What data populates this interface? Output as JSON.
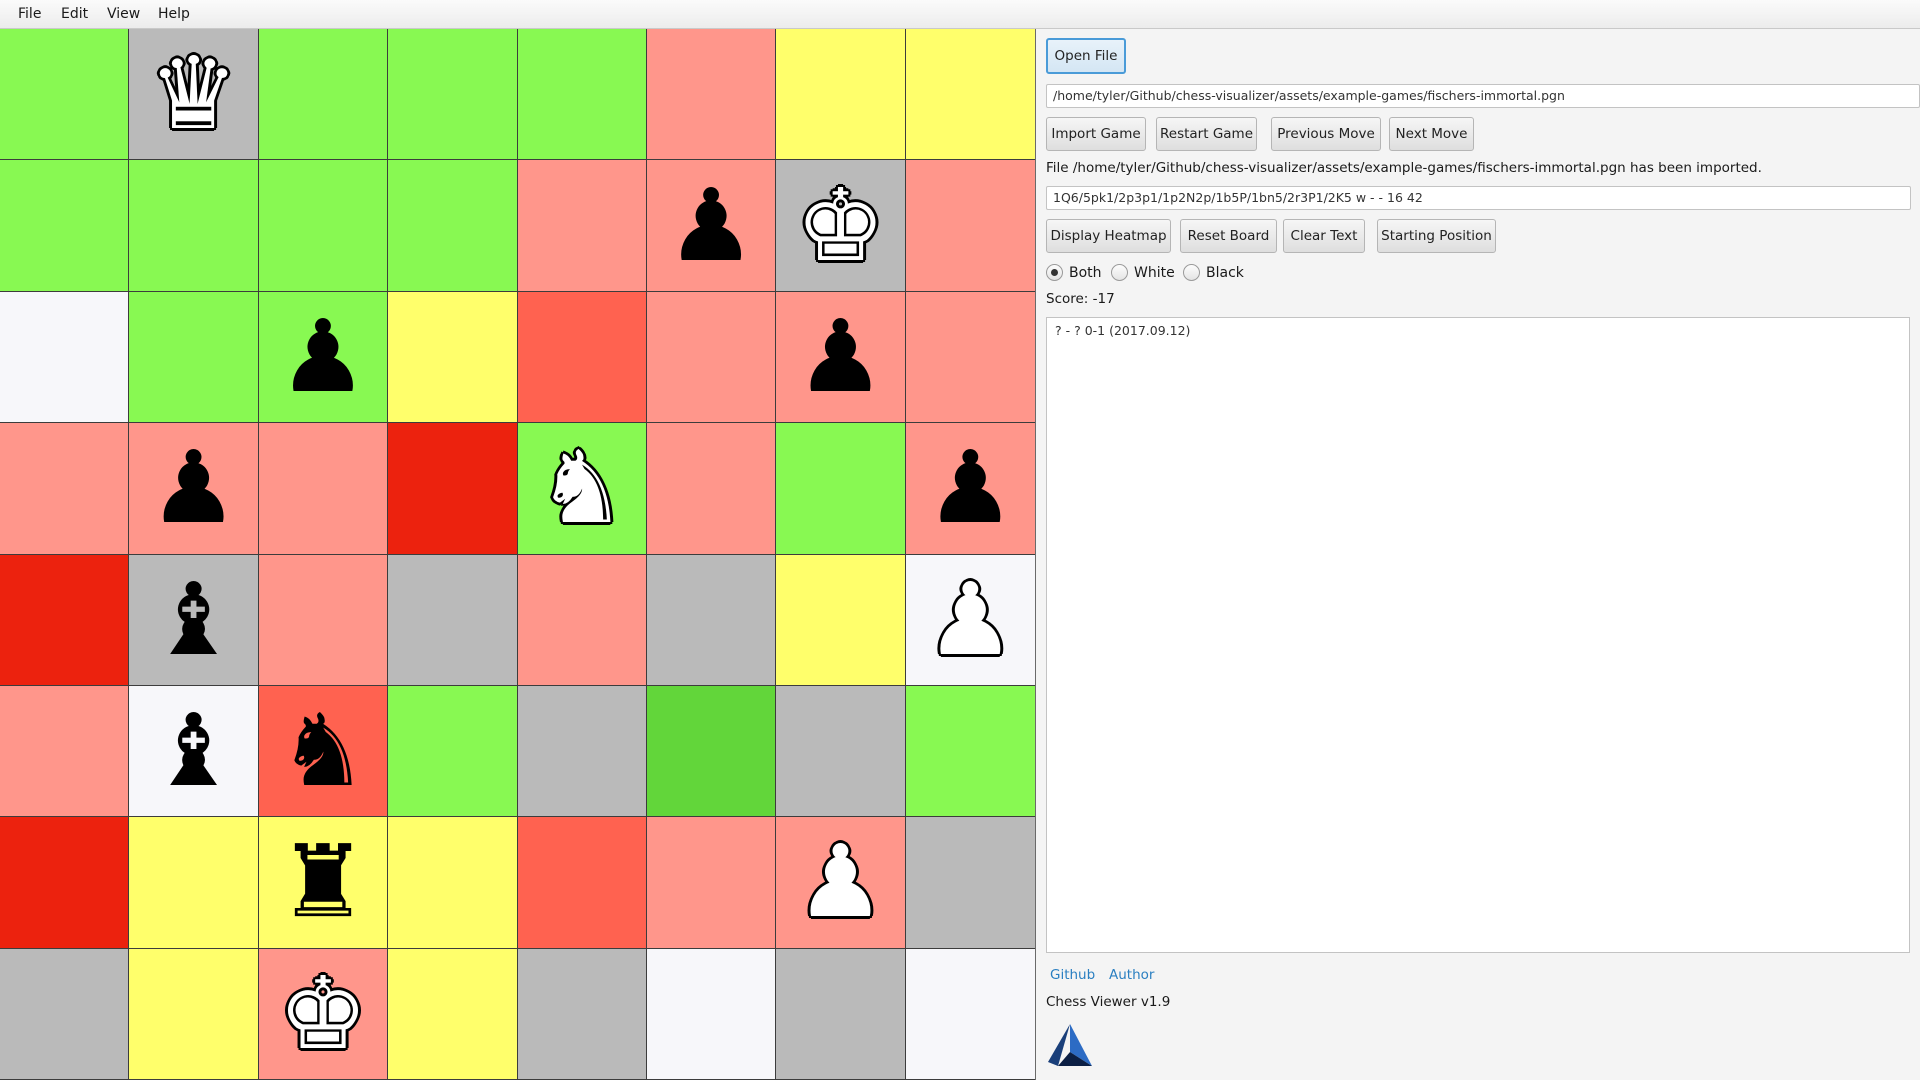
{
  "menu": [
    "File",
    "Edit",
    "View",
    "Help"
  ],
  "colors": {
    "green": "#88f952",
    "dark_green": "#62d63a",
    "yellow": "#ffff6b",
    "pink": "#ff968b",
    "orange_red": "#ff6250",
    "red": "#ec220e",
    "gray": "#bababa",
    "white": "#f7f7fa"
  },
  "board": {
    "square_colors": [
      [
        "green",
        "gray",
        "green",
        "green",
        "green",
        "pink",
        "yellow",
        "yellow"
      ],
      [
        "green",
        "green",
        "green",
        "green",
        "pink",
        "pink",
        "gray",
        "pink"
      ],
      [
        "white",
        "green",
        "green",
        "yellow",
        "orange_red",
        "pink",
        "pink",
        "pink"
      ],
      [
        "pink",
        "pink",
        "pink",
        "red",
        "green",
        "pink",
        "green",
        "pink"
      ],
      [
        "red",
        "gray",
        "pink",
        "gray",
        "pink",
        "gray",
        "yellow",
        "white"
      ],
      [
        "pink",
        "white",
        "orange_red",
        "green",
        "gray",
        "dark_green",
        "gray",
        "green"
      ],
      [
        "red",
        "yellow",
        "black_rook_sq",
        "yellow",
        "orange_red",
        "pink",
        "pink",
        "gray"
      ],
      [
        "gray",
        "yellow",
        "pink",
        "yellow",
        "gray",
        "white",
        "gray",
        "white"
      ]
    ],
    "pieces": [
      [
        null,
        {
          "glyph": "♛",
          "color": "white",
          "name": "white-queen-icon"
        },
        null,
        null,
        null,
        null,
        null,
        null
      ],
      [
        null,
        null,
        null,
        null,
        null,
        {
          "glyph": "♟",
          "color": "black",
          "name": "black-pawn-icon"
        },
        {
          "glyph": "♚",
          "color": "white",
          "name": "black-king-icon"
        },
        null
      ],
      [
        null,
        null,
        {
          "glyph": "♟",
          "color": "black",
          "name": "black-pawn-icon"
        },
        null,
        null,
        null,
        {
          "glyph": "♟",
          "color": "black",
          "name": "black-pawn-icon"
        },
        null
      ],
      [
        null,
        {
          "glyph": "♟",
          "color": "black",
          "name": "black-pawn-icon"
        },
        null,
        null,
        {
          "glyph": "♞",
          "color": "white",
          "name": "white-knight-icon"
        },
        null,
        null,
        {
          "glyph": "♟",
          "color": "black",
          "name": "black-pawn-icon"
        }
      ],
      [
        null,
        {
          "glyph": "♝",
          "color": "black",
          "name": "black-bishop-icon"
        },
        null,
        null,
        null,
        null,
        null,
        {
          "glyph": "♟",
          "color": "white",
          "name": "white-pawn-icon"
        }
      ],
      [
        null,
        {
          "glyph": "♝",
          "color": "black",
          "name": "black-bishop-icon"
        },
        {
          "glyph": "♞",
          "color": "black",
          "name": "black-knight-icon"
        },
        null,
        null,
        null,
        null,
        null
      ],
      [
        null,
        null,
        {
          "glyph": "♜",
          "color": "black",
          "name": "black-rook-icon"
        },
        null,
        null,
        null,
        {
          "glyph": "♟",
          "color": "white",
          "name": "white-pawn-icon"
        },
        null
      ],
      [
        null,
        null,
        {
          "glyph": "♚",
          "color": "white",
          "name": "white-king-icon"
        },
        null,
        null,
        null,
        null,
        null
      ]
    ]
  },
  "panel": {
    "open_file": "Open File",
    "file_path": "/home/tyler/Github/chess-visualizer/assets/example-games/fischers-immortal.pgn",
    "import_game": "Import Game",
    "restart_game": "Restart Game",
    "previous_move": "Previous Move",
    "next_move": "Next Move",
    "import_status": "File /home/tyler/Github/chess-visualizer/assets/example-games/fischers-immortal.pgn has been imported.",
    "fen": "1Q6/5pk1/2p3p1/1p2N2p/1b5P/1bn5/2r3P1/2K5 w - - 16 42",
    "display_heatmap": "Display Heatmap",
    "reset_board": "Reset Board",
    "clear_text": "Clear Text",
    "starting_position": "Starting Position",
    "radio_both": "Both",
    "radio_white": "White",
    "radio_black": "Black",
    "score_label": "Score:",
    "score_value": "-17",
    "game_text": "? - ? 0-1 (2017.09.12)",
    "link_github": "Github",
    "link_author": "Author",
    "version": "Chess Viewer v1.9"
  }
}
